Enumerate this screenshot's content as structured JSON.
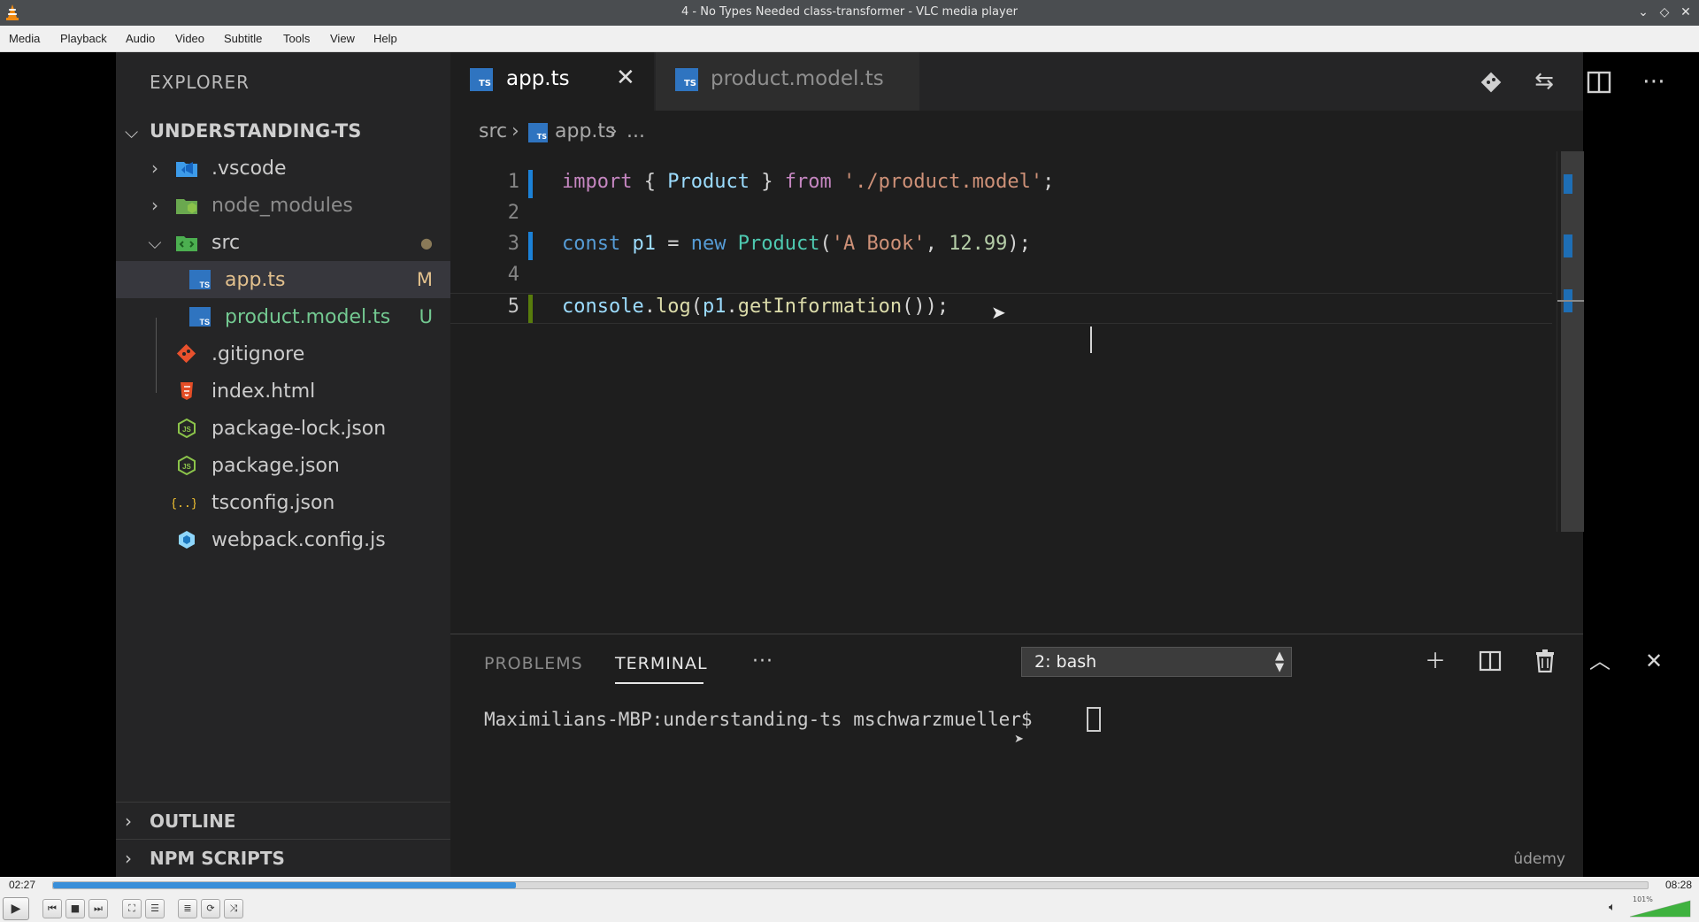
{
  "window": {
    "title": "4 - No Types Needed class-transformer - VLC media player"
  },
  "menu": [
    "Media",
    "Playback",
    "Audio",
    "Video",
    "Subtitle",
    "Tools",
    "View",
    "Help"
  ],
  "sidebar": {
    "title": "EXPLORER",
    "project": "UNDERSTANDING-TS",
    "items": [
      {
        "label": ".vscode",
        "icon": "vscode-folder-icon",
        "color": "#cccccc"
      },
      {
        "label": "node_modules",
        "icon": "node-folder-icon",
        "color": "#8c8c8c"
      },
      {
        "label": "src",
        "icon": "src-folder-icon",
        "color": "#cccccc",
        "badge": "●"
      },
      {
        "label": "app.ts",
        "icon": "typescript-file-icon",
        "color": "#e2c08d",
        "badge": "M"
      },
      {
        "label": "product.model.ts",
        "icon": "typescript-file-icon",
        "color": "#73c991",
        "badge": "U"
      },
      {
        "label": ".gitignore",
        "icon": "git-icon",
        "color": "#cccccc"
      },
      {
        "label": "index.html",
        "icon": "html5-icon",
        "color": "#cccccc"
      },
      {
        "label": "package-lock.json",
        "icon": "nodejs-icon",
        "color": "#cccccc"
      },
      {
        "label": "package.json",
        "icon": "nodejs-icon",
        "color": "#cccccc"
      },
      {
        "label": "tsconfig.json",
        "icon": "json-braces-icon",
        "color": "#cccccc"
      },
      {
        "label": "webpack.config.js",
        "icon": "webpack-icon",
        "color": "#cccccc"
      }
    ],
    "outline": "OUTLINE",
    "npm_scripts": "NPM SCRIPTS"
  },
  "tabs": [
    {
      "label": "app.ts",
      "active": true
    },
    {
      "label": "product.model.ts",
      "active": false
    }
  ],
  "ts_badge": "TS",
  "breadcrumb": {
    "folder": "src",
    "file": "app.ts",
    "more": "..."
  },
  "code": {
    "line_numbers": [
      "1",
      "2",
      "3",
      "4",
      "5"
    ],
    "line1": {
      "kw": "import",
      "open": " { ",
      "id": "Product",
      "close": " } ",
      "kw2": "from",
      "sp": " ",
      "str": "'./product.model'",
      "end": ";"
    },
    "line3": {
      "kw": "const",
      "sp": " ",
      "var": "p1",
      "eq": " = ",
      "kw2": "new",
      "sp2": " ",
      "id": "Product",
      "open": "(",
      "str": "'A Book'",
      "comma": ", ",
      "num": "12.99",
      "end": ");"
    },
    "line5": {
      "var": "console",
      "dot": ".",
      "fn": "log",
      "open": "(",
      "var2": "p1",
      "dot2": ".",
      "fn2": "getInformation",
      "end": "());"
    }
  },
  "panel": {
    "problems": "PROBLEMS",
    "terminal": "TERMINAL",
    "more": "···",
    "shell": "2: bash",
    "prompt": "Maximilians-MBP:understanding-ts mschwarzmueller$ ",
    "watermark": "ûdemy"
  },
  "player": {
    "current_time": "02:27",
    "total_time": "08:28",
    "progress_fraction": 0.29,
    "volume_percent": "101%"
  }
}
